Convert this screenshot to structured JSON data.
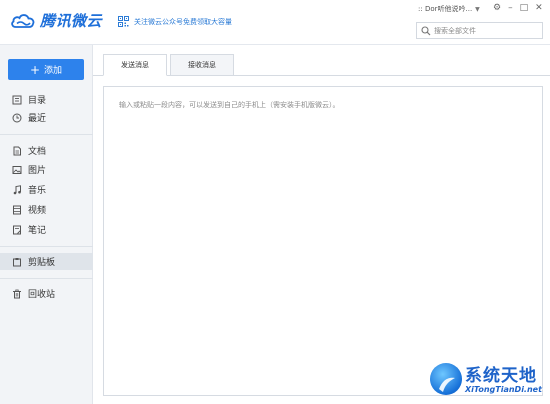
{
  "header": {
    "logo_text": "腾讯微云",
    "promo_text": "关注微云公众号免费领取大容量",
    "user_name": ":: Dor听他说吟...",
    "search_placeholder": "搜索全部文件"
  },
  "sidebar": {
    "add_label": "添加",
    "items": [
      {
        "label": "目录",
        "icon": "directory-icon"
      },
      {
        "label": "最近",
        "icon": "clock-icon"
      },
      {
        "label": "文档",
        "icon": "document-icon"
      },
      {
        "label": "图片",
        "icon": "image-icon"
      },
      {
        "label": "音乐",
        "icon": "music-icon"
      },
      {
        "label": "视频",
        "icon": "video-icon"
      },
      {
        "label": "笔记",
        "icon": "note-icon"
      },
      {
        "label": "剪贴板",
        "icon": "clipboard-icon"
      },
      {
        "label": "回收站",
        "icon": "trash-icon"
      }
    ],
    "active_item": "剪贴板"
  },
  "main": {
    "tabs": [
      {
        "label": "发送消息",
        "active": true
      },
      {
        "label": "接收消息",
        "active": false
      }
    ],
    "editor_placeholder": "输入或粘贴一段内容，可以发送到自己的手机上（需安装手机版微云）。"
  },
  "watermark": {
    "title": "系统天地",
    "url": "XiTongTianDi.net"
  },
  "colors": {
    "accent": "#2d82ec",
    "sidebar_bg": "#f2f4f7",
    "active_bg": "#dfe4ea",
    "link": "#2b7bd6"
  }
}
